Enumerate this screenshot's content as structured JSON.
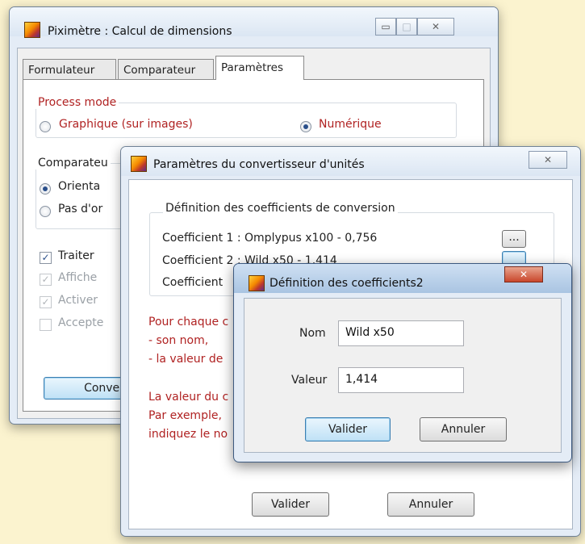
{
  "window_main": {
    "title": "Piximètre : Calcul de dimensions",
    "tabs": [
      "Formulateur",
      "Comparateur",
      "Paramètres"
    ],
    "process_mode": {
      "label": "Process mode",
      "option_graphique": "Graphique (sur images)",
      "option_numerique": "Numérique",
      "selected": "Numérique"
    },
    "comparateur_group": {
      "label": "Comparateu",
      "option_1": "Orienta",
      "option_2": "Pas d'or"
    },
    "checkboxes": [
      {
        "label": "Traiter",
        "checked": true,
        "enabled": true
      },
      {
        "label": "Affiche",
        "checked": true,
        "enabled": false
      },
      {
        "label": "Activer",
        "checked": true,
        "enabled": false
      },
      {
        "label": "Accepte",
        "checked": false,
        "enabled": false
      }
    ],
    "convert_button": "Conver"
  },
  "window_converter": {
    "title": "Paramètres du convertisseur d'unités",
    "group_label": "Définition des coefficients de conversion",
    "coefficients": [
      "Coefficient 1 : Omplypus x100 - 0,756",
      "Coefficient 2 : Wild x50 - 1,414",
      "Coefficient"
    ],
    "browse_button": "...",
    "help_lines": [
      "Pour chaque c",
      "- son nom,",
      "- la valeur de",
      "La valeur du c",
      "Par exemple,",
      "indiquez le no"
    ],
    "validate_button": "Valider",
    "cancel_button": "Annuler"
  },
  "window_coef": {
    "title": "Définition des coefficients2",
    "name_label": "Nom",
    "name_value": "Wild x50",
    "value_label": "Valeur",
    "value_value": "1,414",
    "validate_button": "Valider",
    "cancel_button": "Annuler"
  },
  "icons": {
    "close_glyph": "✕",
    "minimize_glyph": "▭",
    "maximize_glyph": "□",
    "check_glyph": "✓"
  }
}
